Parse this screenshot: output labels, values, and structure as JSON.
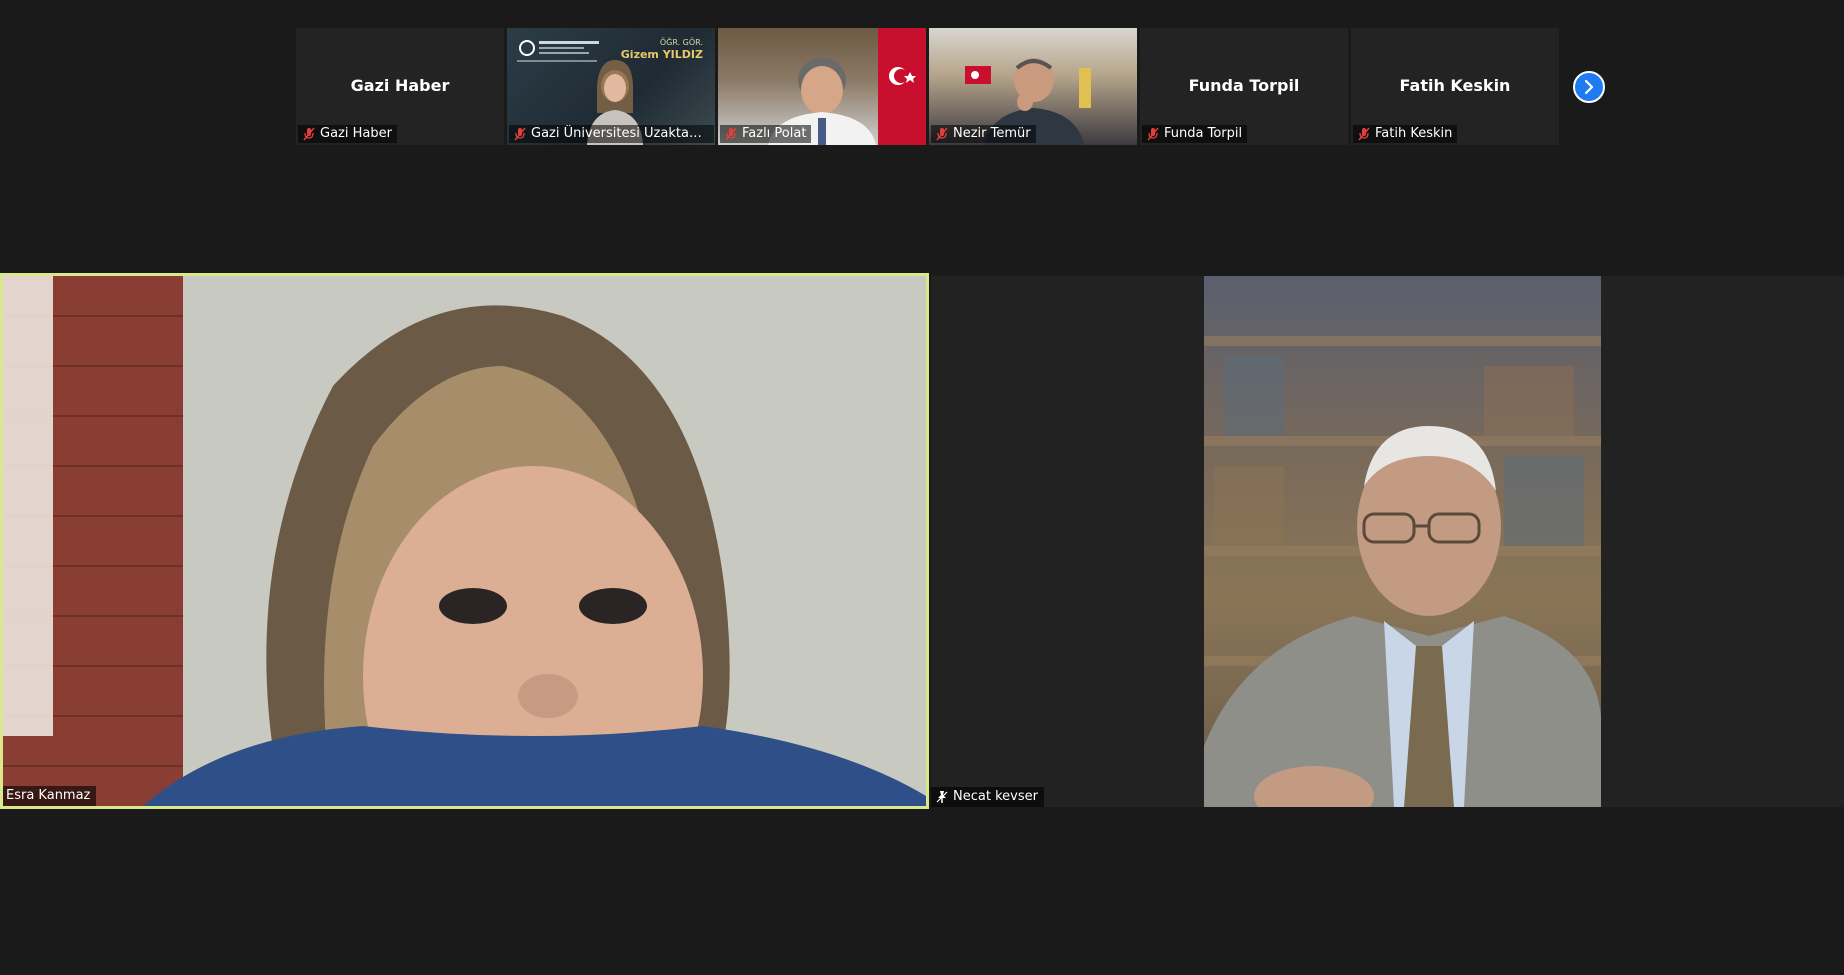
{
  "participants_strip": [
    {
      "name": "Gazi Haber",
      "label": "Gazi Haber",
      "video": false
    },
    {
      "name": "Gazi Üniversitesi Uzaktan Eğitim",
      "label": "Gazi Üniversitesi Uzaktan Eğiti...",
      "video": true,
      "overlay_title": "ÖĞR. GÖR.",
      "overlay_name": "Gizem YILDIZ"
    },
    {
      "name": "Fazlı Polat",
      "label": "Fazlı Polat",
      "video": true
    },
    {
      "name": "Nezir Temür",
      "label": "Nezir Temür",
      "video": true
    },
    {
      "name": "Funda Torpil",
      "label": "Funda Torpil",
      "video": false
    },
    {
      "name": "Fatih Keskin",
      "label": "Fatih Keskin",
      "video": false
    }
  ],
  "main": {
    "active_speaker": {
      "name": "Esra Kanmaz",
      "highlight_color": "#d9e88a"
    },
    "second": {
      "name": "Necat kevser"
    }
  },
  "colors": {
    "background": "#1a1a1a",
    "tile": "#232323",
    "accent": "#1e7bf2",
    "muted_icon": "#e0403c"
  },
  "icons": {
    "muted": "mic-muted-icon",
    "next": "chevron-right-icon",
    "pin": "pin-icon"
  }
}
